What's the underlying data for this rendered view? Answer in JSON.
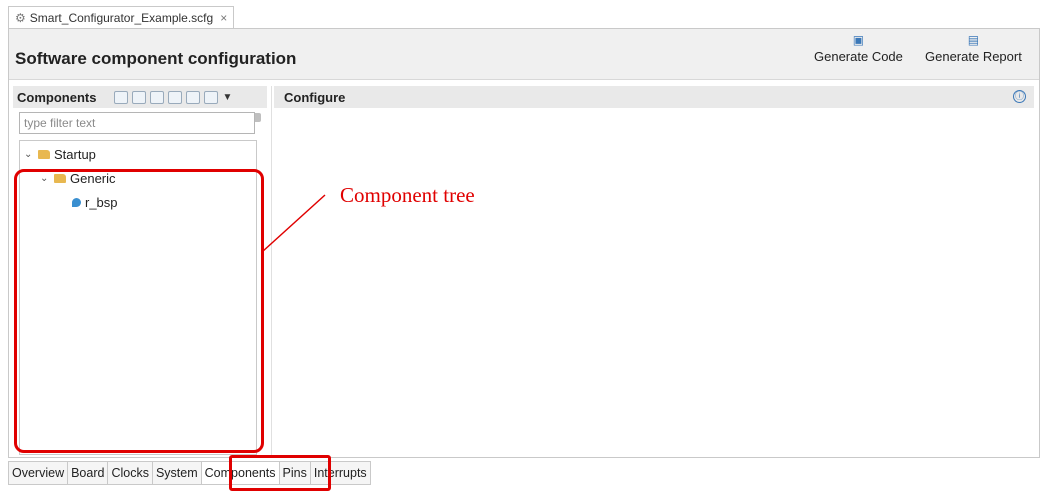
{
  "editor_tab": {
    "title": "Smart_Configurator_Example.scfg",
    "close": "×",
    "icon": "gear-icon"
  },
  "header": {
    "title": "Software component configuration",
    "buttons": {
      "generate_code": "Generate Code",
      "generate_report": "Generate Report"
    }
  },
  "components_panel": {
    "title": "Components",
    "filter_placeholder": "type filter text"
  },
  "tree": {
    "nodes": [
      {
        "label": "Startup"
      },
      {
        "label": "Generic"
      },
      {
        "label": "r_bsp"
      }
    ]
  },
  "configure_panel": {
    "title": "Configure",
    "info_icon": "ⓘ"
  },
  "bottom_tabs": [
    "Overview",
    "Board",
    "Clocks",
    "System",
    "Components",
    "Pins",
    "Interrupts"
  ],
  "annotation": {
    "label": "Component tree",
    "color": "#e00000"
  }
}
